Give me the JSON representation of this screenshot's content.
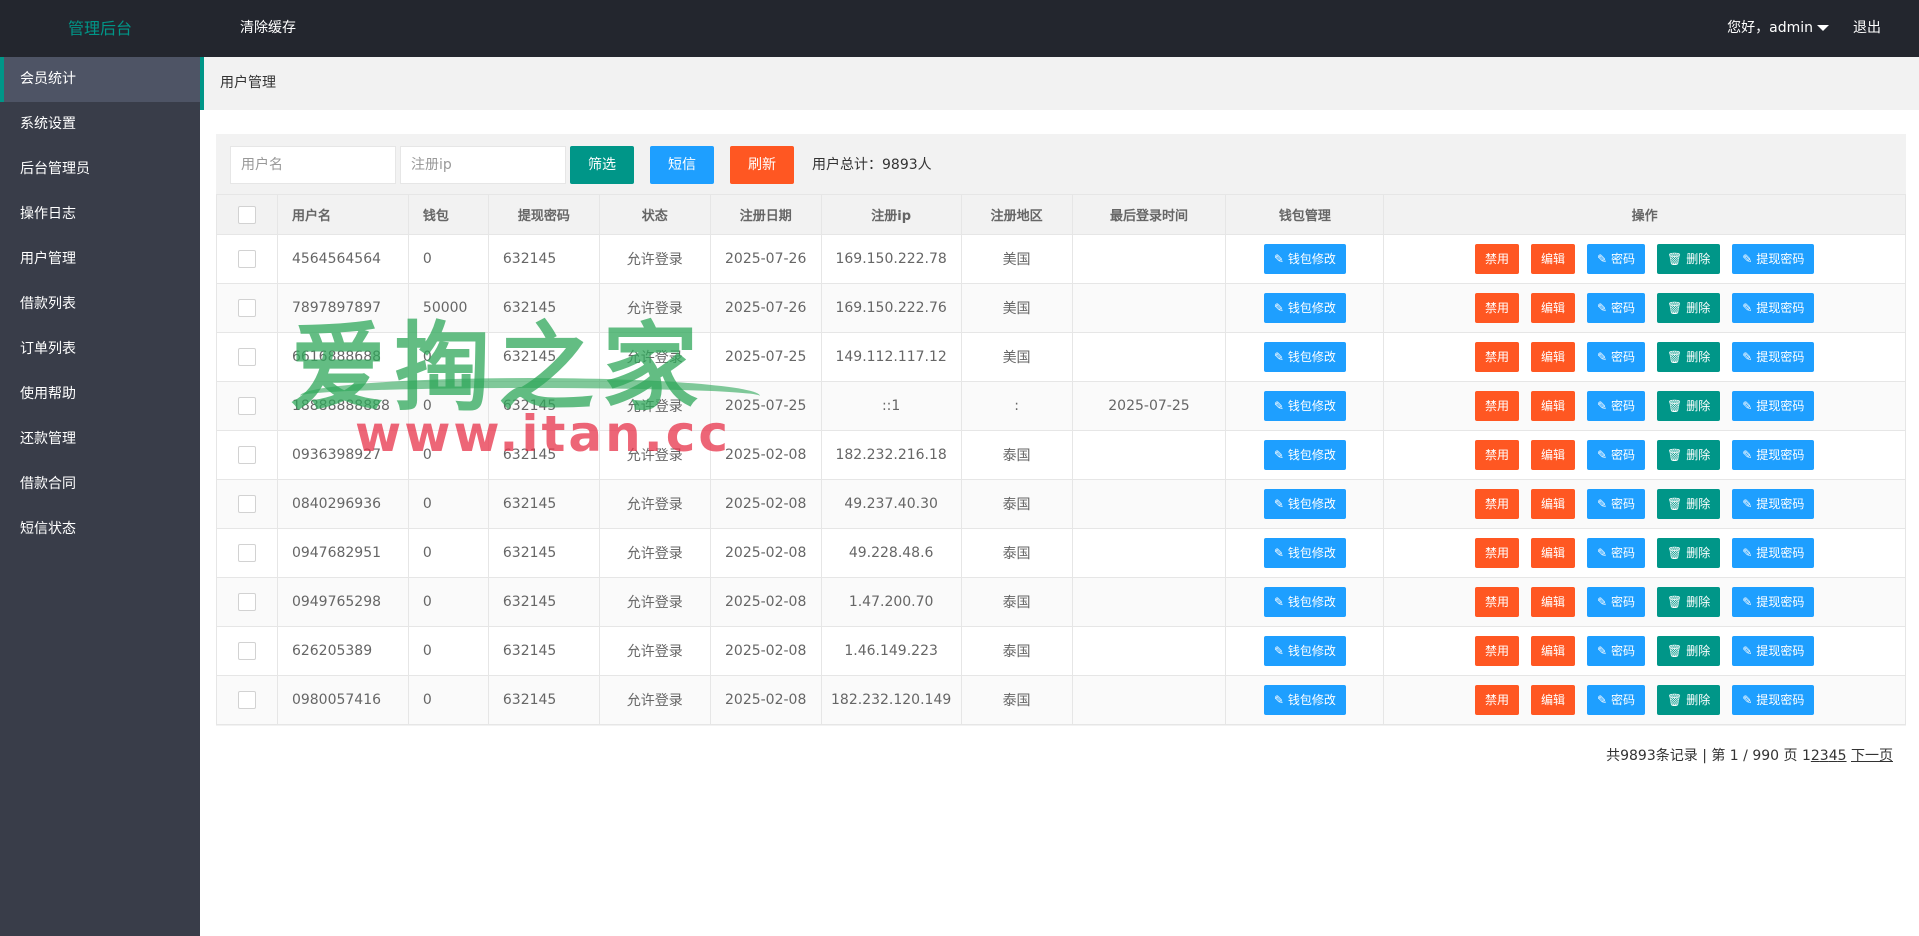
{
  "header": {
    "logo": "管理后台",
    "clear_cache": "清除缓存",
    "greeting": "您好，admin",
    "logout": "退出"
  },
  "sidebar": {
    "items": [
      {
        "label": "会员统计",
        "active": true
      },
      {
        "label": "系统设置"
      },
      {
        "label": "后台管理员"
      },
      {
        "label": "操作日志"
      },
      {
        "label": "用户管理"
      },
      {
        "label": "借款列表"
      },
      {
        "label": "订单列表"
      },
      {
        "label": "使用帮助"
      },
      {
        "label": "还款管理"
      },
      {
        "label": "借款合同"
      },
      {
        "label": "短信状态"
      }
    ]
  },
  "breadcrumb": "用户管理",
  "toolbar": {
    "username_placeholder": "用户名",
    "ip_placeholder": "注册ip",
    "filter_label": "筛选",
    "sms_label": "短信",
    "refresh_label": "刷新",
    "total": "用户总计：9893人"
  },
  "table": {
    "headers": [
      "用户名",
      "钱包",
      "提现密码",
      "状态",
      "注册日期",
      "注册ip",
      "注册地区",
      "最后登录时间",
      "钱包管理",
      "操作"
    ],
    "actions": {
      "wallet_edit": "钱包修改",
      "disable": "禁用",
      "edit": "编辑",
      "password": "密码",
      "delete": "删除",
      "withdraw_password": "提现密码"
    },
    "rows": [
      {
        "username": "4564564564",
        "wallet": "0",
        "withdraw_pw": "632145",
        "status": "允许登录",
        "reg_date": "2025-07-26",
        "reg_ip": "169.150.222.78",
        "region": "美国",
        "last_login": ""
      },
      {
        "username": "7897897897",
        "wallet": "50000",
        "withdraw_pw": "632145",
        "status": "允许登录",
        "reg_date": "2025-07-26",
        "reg_ip": "169.150.222.76",
        "region": "美国",
        "last_login": ""
      },
      {
        "username": "6616888688",
        "wallet": "0",
        "withdraw_pw": "632145",
        "status": "允许登录",
        "reg_date": "2025-07-25",
        "reg_ip": "149.112.117.12",
        "region": "美国",
        "last_login": ""
      },
      {
        "username": "18888888888",
        "wallet": "0",
        "withdraw_pw": "632145",
        "status": "允许登录",
        "reg_date": "2025-07-25",
        "reg_ip": "::1",
        "region": ":",
        "last_login": "2025-07-25"
      },
      {
        "username": "0936398927",
        "wallet": "0",
        "withdraw_pw": "632145",
        "status": "允许登录",
        "reg_date": "2025-02-08",
        "reg_ip": "182.232.216.18",
        "region": "泰国",
        "last_login": ""
      },
      {
        "username": "0840296936",
        "wallet": "0",
        "withdraw_pw": "632145",
        "status": "允许登录",
        "reg_date": "2025-02-08",
        "reg_ip": "49.237.40.30",
        "region": "泰国",
        "last_login": ""
      },
      {
        "username": "0947682951",
        "wallet": "0",
        "withdraw_pw": "632145",
        "status": "允许登录",
        "reg_date": "2025-02-08",
        "reg_ip": "49.228.48.6",
        "region": "泰国",
        "last_login": ""
      },
      {
        "username": "0949765298",
        "wallet": "0",
        "withdraw_pw": "632145",
        "status": "允许登录",
        "reg_date": "2025-02-08",
        "reg_ip": "1.47.200.70",
        "region": "泰国",
        "last_login": ""
      },
      {
        "username": "626205389",
        "wallet": "0",
        "withdraw_pw": "632145",
        "status": "允许登录",
        "reg_date": "2025-02-08",
        "reg_ip": "1.46.149.223",
        "region": "泰国",
        "last_login": ""
      },
      {
        "username": "0980057416",
        "wallet": "0",
        "withdraw_pw": "632145",
        "status": "允许登录",
        "reg_date": "2025-02-08",
        "reg_ip": "182.232.120.149",
        "region": "泰国",
        "last_login": ""
      }
    ]
  },
  "pager": {
    "summary": "共9893条记录 | 第 1 / 990 页 1",
    "pages": [
      "2",
      "3",
      "4",
      "5"
    ],
    "next": "下一页"
  },
  "watermark": {
    "title": "爱掏之家",
    "url": "www.itan.cc"
  },
  "colors": {
    "header_bg": "#23262e",
    "sidebar_bg": "#393d49",
    "accent_green": "#009688",
    "blue": "#1e9fff",
    "orange": "#ff5722"
  }
}
